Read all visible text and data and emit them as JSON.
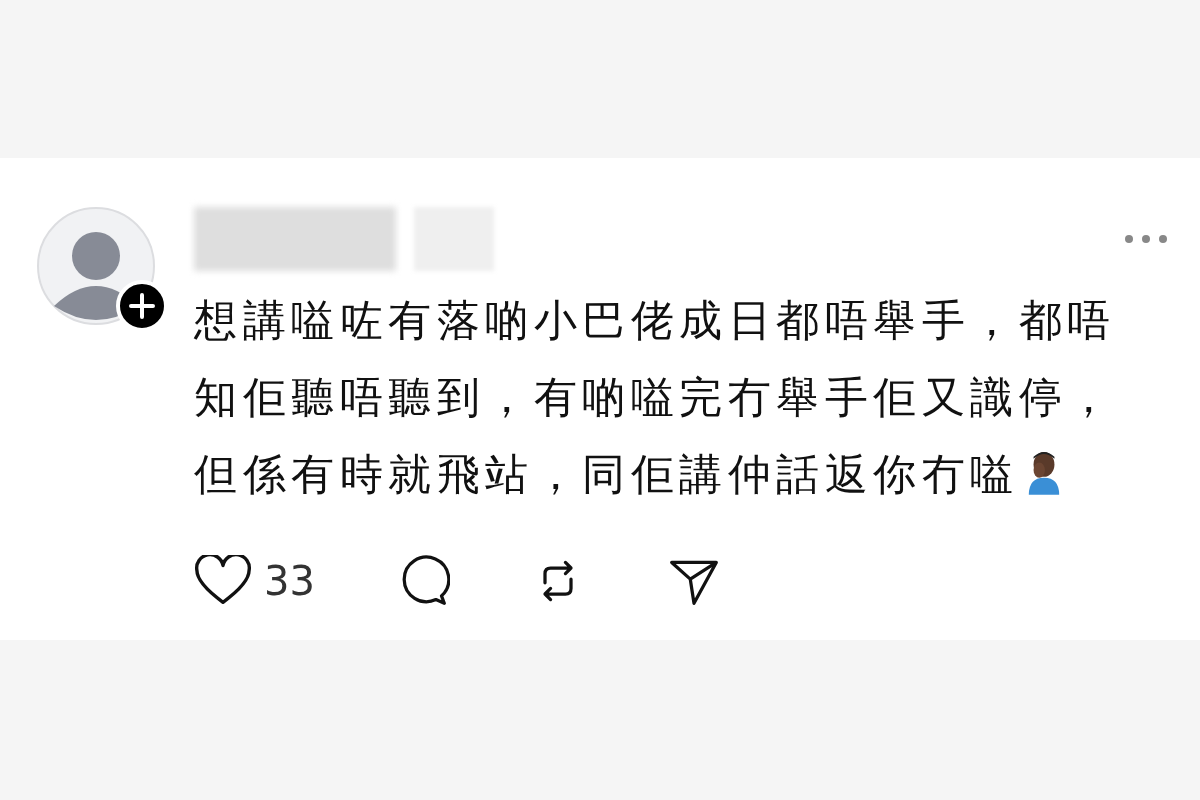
{
  "post": {
    "text": "想講嗌咗有落啲小巴佬成日都唔舉手，都唔知佢聽唔聽到，有啲嗌完冇舉手佢又識停，但係有時就飛站，同佢講仲話返你冇嗌",
    "likes": "33"
  }
}
